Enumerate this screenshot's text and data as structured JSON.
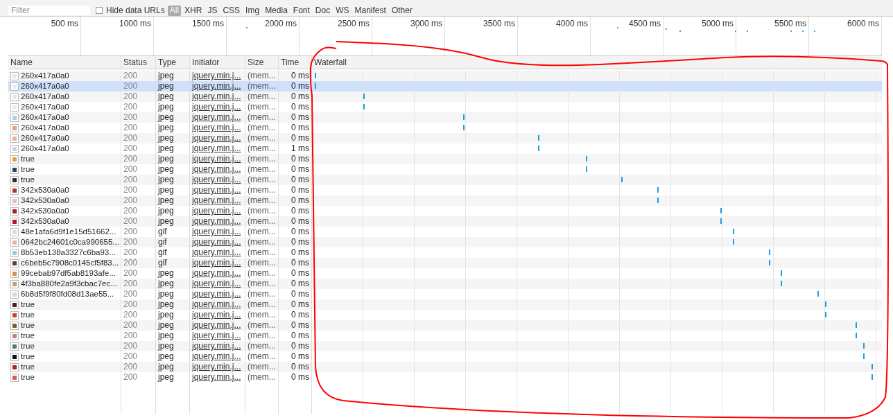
{
  "filter": {
    "placeholder": "Filter"
  },
  "hide_data_urls": {
    "label": "Hide data URLs",
    "checked": false
  },
  "types": [
    {
      "label": "All",
      "selected": true
    },
    {
      "label": "XHR",
      "selected": false
    },
    {
      "label": "JS",
      "selected": false
    },
    {
      "label": "CSS",
      "selected": false
    },
    {
      "label": "Img",
      "selected": false
    },
    {
      "label": "Media",
      "selected": false
    },
    {
      "label": "Font",
      "selected": false
    },
    {
      "label": "Doc",
      "selected": false
    },
    {
      "label": "WS",
      "selected": false
    },
    {
      "label": "Manifest",
      "selected": false
    },
    {
      "label": "Other",
      "selected": false
    }
  ],
  "overview_ticks": [
    "500 ms",
    "1000 ms",
    "1500 ms",
    "2000 ms",
    "2500 ms",
    "3000 ms",
    "3500 ms",
    "4000 ms",
    "4500 ms",
    "5000 ms",
    "5500 ms",
    "6000 ms"
  ],
  "table": {
    "columns": [
      "Name",
      "Status",
      "Type",
      "Initiator",
      "Size",
      "Time",
      "Waterfall"
    ],
    "rows": [
      {
        "name": "260x417a0a0",
        "status": "200",
        "type": "jpeg",
        "initiator": "jquery.min.j...",
        "size": "(mem...",
        "time": "0 ms",
        "color": "#e8e8e8",
        "selected": false
      },
      {
        "name": "260x417a0a0",
        "status": "200",
        "type": "jpeg",
        "initiator": "jquery.min.j...",
        "size": "(mem...",
        "time": "0 ms",
        "color": "#eeeeee",
        "selected": true
      },
      {
        "name": "260x417a0a0",
        "status": "200",
        "type": "jpeg",
        "initiator": "jquery.min.j...",
        "size": "(mem...",
        "time": "0 ms",
        "color": "#e6e6e6",
        "selected": false
      },
      {
        "name": "260x417a0a0",
        "status": "200",
        "type": "jpeg",
        "initiator": "jquery.min.j...",
        "size": "(mem...",
        "time": "0 ms",
        "color": "#ececec",
        "selected": false
      },
      {
        "name": "260x417a0a0",
        "status": "200",
        "type": "jpeg",
        "initiator": "jquery.min.j...",
        "size": "(mem...",
        "time": "0 ms",
        "color": "#b8c8d8",
        "selected": false
      },
      {
        "name": "260x417a0a0",
        "status": "200",
        "type": "jpeg",
        "initiator": "jquery.min.j...",
        "size": "(mem...",
        "time": "0 ms",
        "color": "#e8a080",
        "selected": false
      },
      {
        "name": "260x417a0a0",
        "status": "200",
        "type": "jpeg",
        "initiator": "jquery.min.j...",
        "size": "(mem...",
        "time": "0 ms",
        "color": "#e8b0a0",
        "selected": false
      },
      {
        "name": "260x417a0a0",
        "status": "200",
        "type": "jpeg",
        "initiator": "jquery.min.j...",
        "size": "(mem...",
        "time": "1 ms",
        "color": "#c8d4e0",
        "selected": false
      },
      {
        "name": "true",
        "status": "200",
        "type": "jpeg",
        "initiator": "jquery.min.j...",
        "size": "(mem...",
        "time": "0 ms",
        "color": "#e0a040",
        "selected": false
      },
      {
        "name": "true",
        "status": "200",
        "type": "jpeg",
        "initiator": "jquery.min.j...",
        "size": "(mem...",
        "time": "0 ms",
        "color": "#304070",
        "selected": false
      },
      {
        "name": "true",
        "status": "200",
        "type": "jpeg",
        "initiator": "jquery.min.j...",
        "size": "(mem...",
        "time": "0 ms",
        "color": "#303030",
        "selected": false
      },
      {
        "name": "342x530a0a0",
        "status": "200",
        "type": "jpeg",
        "initiator": "jquery.min.j...",
        "size": "(mem...",
        "time": "0 ms",
        "color": "#c03030",
        "selected": false
      },
      {
        "name": "342x530a0a0",
        "status": "200",
        "type": "jpeg",
        "initiator": "jquery.min.j...",
        "size": "(mem...",
        "time": "0 ms",
        "color": "#e0c0c0",
        "selected": false
      },
      {
        "name": "342x530a0a0",
        "status": "200",
        "type": "jpeg",
        "initiator": "jquery.min.j...",
        "size": "(mem...",
        "time": "0 ms",
        "color": "#a02030",
        "selected": false
      },
      {
        "name": "342x530a0a0",
        "status": "200",
        "type": "jpeg",
        "initiator": "jquery.min.j...",
        "size": "(mem...",
        "time": "0 ms",
        "color": "#b01828",
        "selected": false
      },
      {
        "name": "48e1afa6d9f1e15d51662...",
        "status": "200",
        "type": "gif",
        "initiator": "jquery.min.j...",
        "size": "(mem...",
        "time": "0 ms",
        "color": "#d8e0d8",
        "selected": false
      },
      {
        "name": "0642bc24601c0ca990655...",
        "status": "200",
        "type": "gif",
        "initiator": "jquery.min.j...",
        "size": "(mem...",
        "time": "0 ms",
        "color": "#f0b0a0",
        "selected": false
      },
      {
        "name": "8b53eb138a3327c6ba93...",
        "status": "200",
        "type": "gif",
        "initiator": "jquery.min.j...",
        "size": "(mem...",
        "time": "0 ms",
        "color": "#a0c8d8",
        "selected": false
      },
      {
        "name": "c6beb5c7908c0145cf5f83...",
        "status": "200",
        "type": "gif",
        "initiator": "jquery.min.j...",
        "size": "(mem...",
        "time": "0 ms",
        "color": "#604030",
        "selected": false
      },
      {
        "name": "99cebab97df5ab8193afe...",
        "status": "200",
        "type": "jpeg",
        "initiator": "jquery.min.j...",
        "size": "(mem...",
        "time": "0 ms",
        "color": "#d09050",
        "selected": false
      },
      {
        "name": "4f3ba880fe2a9f3cbac7ec...",
        "status": "200",
        "type": "jpeg",
        "initiator": "jquery.min.j...",
        "size": "(mem...",
        "time": "0 ms",
        "color": "#c8a070",
        "selected": false
      },
      {
        "name": "6b8d5f9f80fd08d13ae55...",
        "status": "200",
        "type": "jpeg",
        "initiator": "jquery.min.j...",
        "size": "(mem...",
        "time": "0 ms",
        "color": "#c8dcf0",
        "selected": false
      },
      {
        "name": "true",
        "status": "200",
        "type": "jpeg",
        "initiator": "jquery.min.j...",
        "size": "(mem...",
        "time": "0 ms",
        "color": "#402818",
        "selected": false
      },
      {
        "name": "true",
        "status": "200",
        "type": "jpeg",
        "initiator": "jquery.min.j...",
        "size": "(mem...",
        "time": "0 ms",
        "color": "#d04020",
        "selected": false
      },
      {
        "name": "true",
        "status": "200",
        "type": "jpeg",
        "initiator": "jquery.min.j...",
        "size": "(mem...",
        "time": "0 ms",
        "color": "#806020",
        "selected": false
      },
      {
        "name": "true",
        "status": "200",
        "type": "jpeg",
        "initiator": "jquery.min.j...",
        "size": "(mem...",
        "time": "0 ms",
        "color": "#c08080",
        "selected": false
      },
      {
        "name": "true",
        "status": "200",
        "type": "jpeg",
        "initiator": "jquery.min.j...",
        "size": "(mem...",
        "time": "0 ms",
        "color": "#607080",
        "selected": false
      },
      {
        "name": "true",
        "status": "200",
        "type": "jpeg",
        "initiator": "jquery.min.j...",
        "size": "(mem...",
        "time": "0 ms",
        "color": "#101010",
        "selected": false
      },
      {
        "name": "true",
        "status": "200",
        "type": "jpeg",
        "initiator": "jquery.min.j...",
        "size": "(mem...",
        "time": "0 ms",
        "color": "#b02020",
        "selected": false
      },
      {
        "name": "true",
        "status": "200",
        "type": "jpeg",
        "initiator": "jquery.min.j...",
        "size": "(mem...",
        "time": "0 ms",
        "color": "#d06060",
        "selected": false
      }
    ]
  }
}
